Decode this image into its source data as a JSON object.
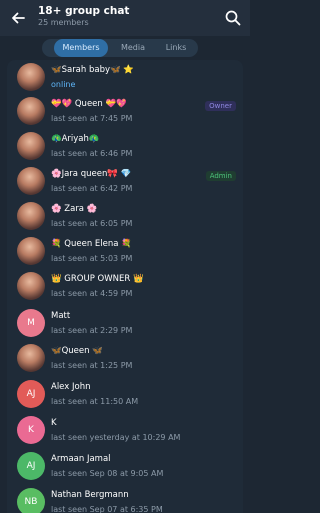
{
  "header": {
    "title": "18+ group chat",
    "subtitle": "25 members"
  },
  "tabs": [
    {
      "label": "Members",
      "active": true
    },
    {
      "label": "Media",
      "active": false
    },
    {
      "label": "Links",
      "active": false
    }
  ],
  "members": [
    {
      "name": "🦋Sarah baby🦋 ⭐",
      "status": "online",
      "avatar": "photo"
    },
    {
      "name": "💝💖 Queen 💝💖",
      "status": "last seen at 7:45 PM",
      "avatar": "photo",
      "badge": "Owner"
    },
    {
      "name": "🦚Ariyah🦚",
      "status": "last seen at 6:46 PM",
      "avatar": "photo"
    },
    {
      "name": "🌸Jara queen🎀 💎",
      "status": "last seen at 6:42 PM",
      "avatar": "photo",
      "badge": "Admin"
    },
    {
      "name": "🌸 Zara 🌸",
      "status": "last seen at 6:05 PM",
      "avatar": "photo"
    },
    {
      "name": "💐 Queen Elena 💐",
      "status": "last seen at 5:03 PM",
      "avatar": "photo"
    },
    {
      "name": "👑 GROUP OWNER 👑",
      "status": "last seen at 4:59 PM",
      "avatar": "photo"
    },
    {
      "name": "Matt",
      "status": "last seen at 2:29 PM",
      "avatar": "initials",
      "initials": "M",
      "color": "#e9798d"
    },
    {
      "name": "🦋Queen 🦋",
      "status": "last seen at 1:25 PM",
      "avatar": "photo"
    },
    {
      "name": "Alex John",
      "status": "last seen at 11:50 AM",
      "avatar": "initials",
      "initials": "AJ",
      "color": "#e25b58"
    },
    {
      "name": "K",
      "status": "last seen yesterday at 10:29 AM",
      "avatar": "initials",
      "initials": "K",
      "color": "#ea6a93"
    },
    {
      "name": "Armaan Jamal",
      "status": "last seen Sep 08 at 9:05 AM",
      "avatar": "initials",
      "initials": "AJ",
      "color": "#4cb868"
    },
    {
      "name": "Nathan Bergmann",
      "status": "last seen Sep 07 at 6:35 PM",
      "avatar": "initials",
      "initials": "NB",
      "color": "#59bd62"
    }
  ]
}
